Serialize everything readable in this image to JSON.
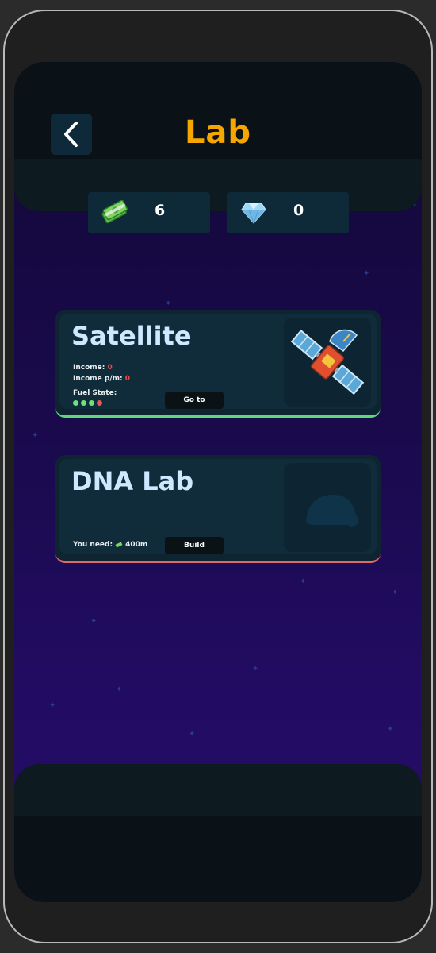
{
  "header": {
    "title": "Lab"
  },
  "currencies": {
    "cash": {
      "icon": "cash-icon",
      "value": "6"
    },
    "diamond": {
      "icon": "diamond-icon",
      "value": "0"
    }
  },
  "labs": [
    {
      "title": "Satellite",
      "income_label": "Income:",
      "income_value": "0",
      "income_pm_label": "Income p/m:",
      "income_pm_value": "0",
      "fuel_label": "Fuel State:",
      "button_label": "Go to",
      "accent_color": "#5fd87a",
      "icon": "satellite-icon"
    },
    {
      "title": "DNA Lab",
      "need_label": "You need:",
      "need_value": "400m",
      "button_label": "Build",
      "accent_color": "#e06a6a",
      "icon": "dna-lab-icon"
    }
  ],
  "fuel_dots": [
    {
      "color": "#6fe07a"
    },
    {
      "color": "#6fe07a"
    },
    {
      "color": "#6fe07a"
    },
    {
      "color": "#e05a5a"
    }
  ],
  "colors": {
    "title": "#f5a600",
    "background_top": "#120838",
    "background_bottom": "#240d66"
  }
}
